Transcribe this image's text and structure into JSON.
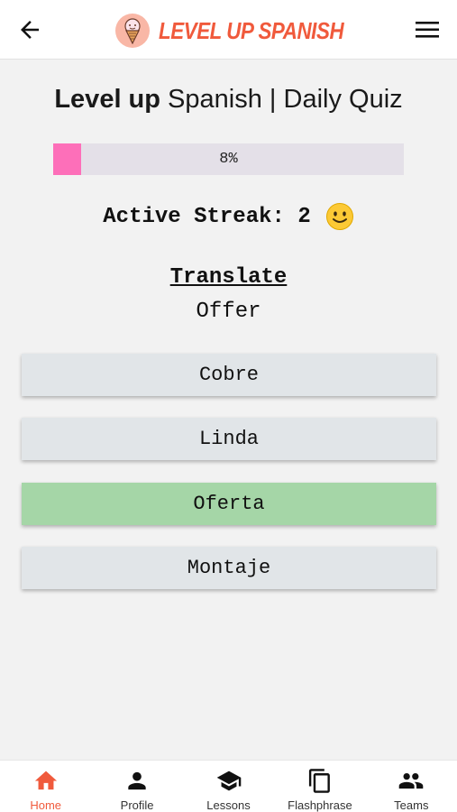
{
  "header": {
    "brand_name": "LEVEL UP SPANISH",
    "back_icon": "arrow-left-icon",
    "menu_icon": "hamburger-menu-icon",
    "logo_icon": "ice-cream-logo-icon"
  },
  "title": {
    "bold": "Level up",
    "rest": " Spanish | Daily Quiz"
  },
  "progress": {
    "percent": 8,
    "label": "8%",
    "fill_color": "#fd6fb9",
    "track_color": "#e4e0e8"
  },
  "streak": {
    "label": "Active Streak: 2",
    "emoji": "smiling-face-icon"
  },
  "question": {
    "prompt": "Translate",
    "word": "Offer"
  },
  "answers": [
    {
      "label": "Cobre",
      "state": "default"
    },
    {
      "label": "Linda",
      "state": "default"
    },
    {
      "label": "Oferta",
      "state": "correct"
    },
    {
      "label": "Montaje",
      "state": "default"
    }
  ],
  "colors": {
    "brand": "#f05a3c",
    "correct": "#a5d6a7",
    "answer_bg": "#e1e5e8"
  },
  "bottom_nav": [
    {
      "label": "Home",
      "icon": "home-icon",
      "active": true
    },
    {
      "label": "Profile",
      "icon": "person-icon",
      "active": false
    },
    {
      "label": "Lessons",
      "icon": "graduation-cap-icon",
      "active": false
    },
    {
      "label": "Flashphrase",
      "icon": "copy-cards-icon",
      "active": false
    },
    {
      "label": "Teams",
      "icon": "group-icon",
      "active": false
    }
  ]
}
